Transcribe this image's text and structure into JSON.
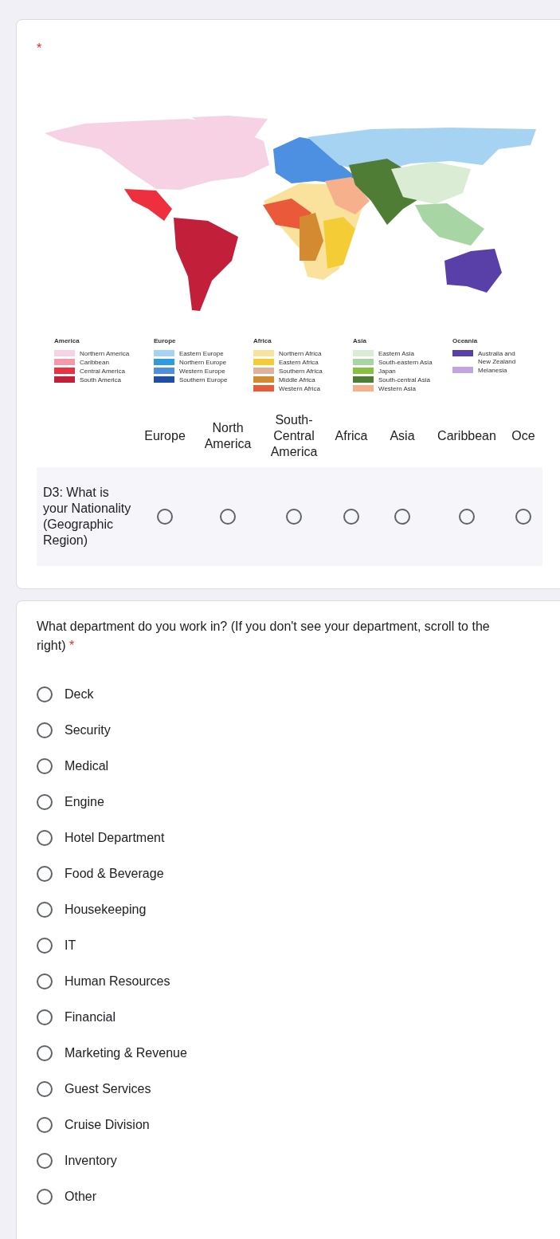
{
  "map_question": {
    "required_mark": "*",
    "legend": [
      {
        "title": "America",
        "items": [
          {
            "label": "Northern America",
            "color": "#f6d2e4"
          },
          {
            "label": "Caribbean",
            "color": "#f29aa8"
          },
          {
            "label": "Central America",
            "color": "#ee2f3e"
          },
          {
            "label": "South America",
            "color": "#c21f3a"
          }
        ]
      },
      {
        "title": "Europe",
        "items": [
          {
            "label": "Eastern Europe",
            "color": "#a7d3f2"
          },
          {
            "label": "Northern Europe",
            "color": "#2e9bdc"
          },
          {
            "label": "Western Europe",
            "color": "#4d8fe0"
          },
          {
            "label": "Southern Europe",
            "color": "#1d4fa8"
          }
        ]
      },
      {
        "title": "Africa",
        "items": [
          {
            "label": "Northern Africa",
            "color": "#fbe29c"
          },
          {
            "label": "Eastern Africa",
            "color": "#f4cd36"
          },
          {
            "label": "Southern Africa",
            "color": "#e2b19c"
          },
          {
            "label": "Middle Africa",
            "color": "#d38a30"
          },
          {
            "label": "Western Africa",
            "color": "#e9593a"
          }
        ]
      },
      {
        "title": "Asia",
        "items": [
          {
            "label": "Eastern Asia",
            "color": "#daecd4"
          },
          {
            "label": "South-eastern Asia",
            "color": "#a7d6a4"
          },
          {
            "label": "Japan",
            "color": "#86c23d"
          },
          {
            "label": "South-central Asia",
            "color": "#4f7d36"
          },
          {
            "label": "Western Asia",
            "color": "#f6b08c"
          }
        ]
      },
      {
        "title": "Oceania",
        "items": [
          {
            "label": "Australia and New Zealand",
            "color": "#5940a8"
          },
          {
            "label": "Melanesia",
            "color": "#c2a4df"
          }
        ]
      }
    ],
    "grid": {
      "columns": [
        "Europe",
        "North America",
        "South-Central America",
        "Africa",
        "Asia",
        "Caribbean",
        "Oce"
      ],
      "rows": [
        {
          "label": "D3: What is your Nationality (Geographic Region)",
          "options": [
            {
              "selected": false
            },
            {
              "selected": false
            },
            {
              "selected": false
            },
            {
              "selected": false
            },
            {
              "selected": false
            },
            {
              "selected": false
            },
            {
              "selected": false
            }
          ]
        }
      ]
    }
  },
  "department_question": {
    "title": "What department do you work in? (If you don't see your department, scroll to the right)",
    "required_mark": "*",
    "options": [
      {
        "label": "Deck",
        "selected": false
      },
      {
        "label": "Security",
        "selected": false
      },
      {
        "label": "Medical",
        "selected": false
      },
      {
        "label": "Engine",
        "selected": false
      },
      {
        "label": "Hotel Department",
        "selected": false
      },
      {
        "label": "Food & Beverage",
        "selected": false
      },
      {
        "label": "Housekeeping",
        "selected": false
      },
      {
        "label": "IT",
        "selected": false
      },
      {
        "label": "Human Resources",
        "selected": false
      },
      {
        "label": "Financial",
        "selected": false
      },
      {
        "label": "Marketing & Revenue",
        "selected": false
      },
      {
        "label": "Guest Services",
        "selected": false
      },
      {
        "label": "Cruise Division",
        "selected": false
      },
      {
        "label": "Inventory",
        "selected": false
      },
      {
        "label": "Other",
        "selected": false
      }
    ]
  }
}
